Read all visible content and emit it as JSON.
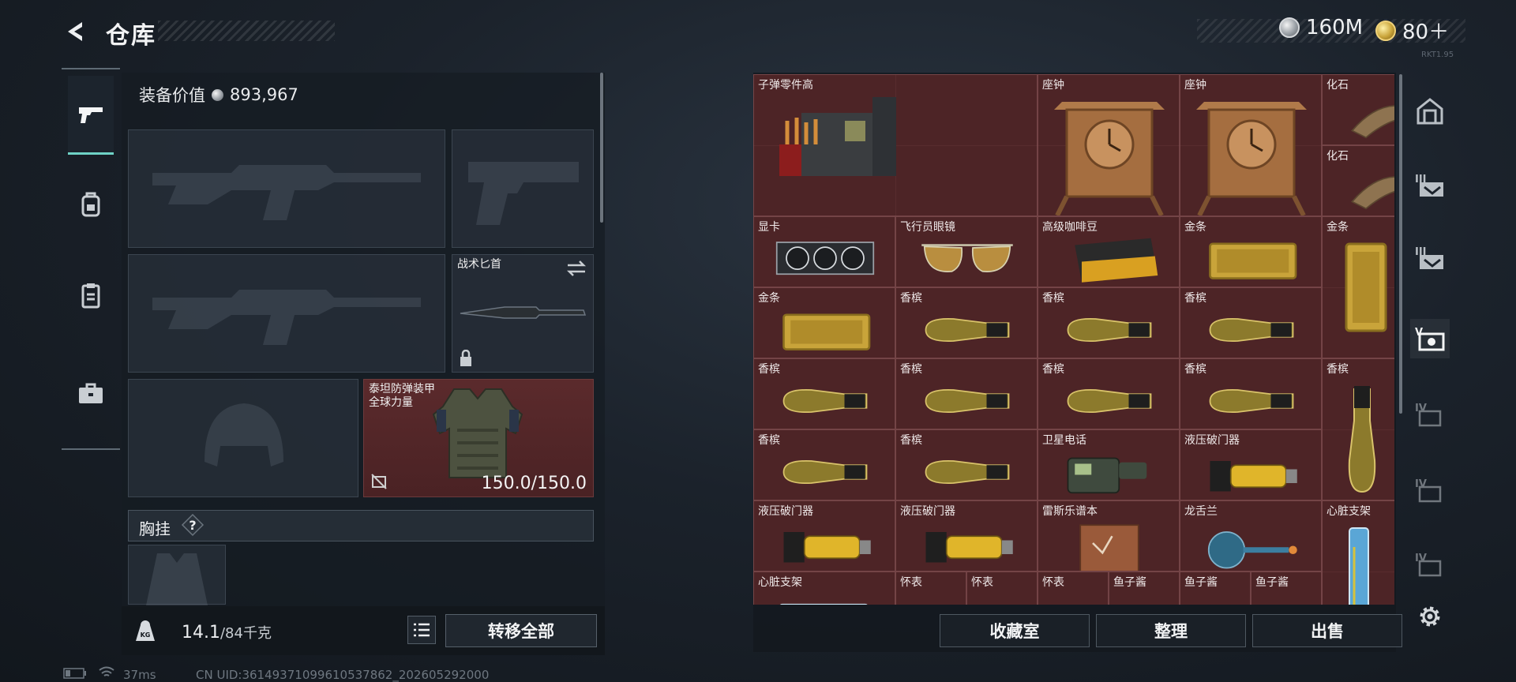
{
  "header": {
    "title": "仓库",
    "currency": [
      {
        "icon": "silver-coin-icon",
        "value": "160M"
      },
      {
        "icon": "gold-coin-icon",
        "value": "80＋"
      }
    ],
    "tiny_text": "RKT1.95"
  },
  "left_nav": [
    {
      "icon": "pistol-icon",
      "active": true
    },
    {
      "icon": "backpack-icon",
      "active": false
    },
    {
      "icon": "clipboard-icon",
      "active": false
    },
    {
      "icon": "briefcase-icon",
      "active": false
    }
  ],
  "equipment": {
    "value_label": "装备价值",
    "value": "893,967",
    "knife_label": "战术匕首",
    "armor_label": "泰坦防弹装甲\n全球力量",
    "armor_durability": "150.0/150.0",
    "vest_label": "胸挂",
    "help_symbol": "?"
  },
  "bottom": {
    "weight_current": "14.1",
    "weight_max": "/84千克",
    "transfer_all": "转移全部"
  },
  "grid": {
    "items": [
      {
        "label": "子弹零件高",
        "col": 0,
        "row": 0,
        "w": 2,
        "h": 2,
        "icon": "ammo-crate-icon"
      },
      {
        "label": "座钟",
        "col": 2,
        "row": 0,
        "w": 1,
        "h": 2,
        "icon": "clock-icon"
      },
      {
        "label": "座钟",
        "col": 3,
        "row": 0,
        "w": 1,
        "h": 2,
        "icon": "clock-icon"
      },
      {
        "label": "化石",
        "col": 4,
        "row": 0,
        "w": 1,
        "h": 1,
        "icon": "fossil-claw-icon"
      },
      {
        "label": "化石",
        "col": 4,
        "row": 1,
        "w": 1,
        "h": 1,
        "icon": "fossil-claw-icon"
      },
      {
        "label": "显卡",
        "col": 0,
        "row": 2,
        "w": 1,
        "h": 1,
        "icon": "graphics-card-icon"
      },
      {
        "label": "飞行员眼镜",
        "col": 1,
        "row": 2,
        "w": 1,
        "h": 1,
        "icon": "aviator-glasses-icon"
      },
      {
        "label": "高级咖啡豆",
        "col": 2,
        "row": 2,
        "w": 1,
        "h": 1,
        "icon": "coffee-bag-icon"
      },
      {
        "label": "金条",
        "col": 3,
        "row": 2,
        "w": 1,
        "h": 1,
        "icon": "gold-bar-icon"
      },
      {
        "label": "金条",
        "col": 4,
        "row": 2,
        "w": 1,
        "h": 2,
        "icon": "gold-bar-vertical-icon"
      },
      {
        "label": "金条",
        "col": 0,
        "row": 3,
        "w": 1,
        "h": 1,
        "icon": "gold-bar-icon"
      },
      {
        "label": "香槟",
        "col": 1,
        "row": 3,
        "w": 1,
        "h": 1,
        "icon": "champagne-icon"
      },
      {
        "label": "香槟",
        "col": 2,
        "row": 3,
        "w": 1,
        "h": 1,
        "icon": "champagne-icon"
      },
      {
        "label": "香槟",
        "col": 3,
        "row": 3,
        "w": 1,
        "h": 1,
        "icon": "champagne-icon"
      },
      {
        "label": "香槟",
        "col": 0,
        "row": 4,
        "w": 1,
        "h": 1,
        "icon": "champagne-icon"
      },
      {
        "label": "香槟",
        "col": 1,
        "row": 4,
        "w": 1,
        "h": 1,
        "icon": "champagne-icon"
      },
      {
        "label": "香槟",
        "col": 2,
        "row": 4,
        "w": 1,
        "h": 1,
        "icon": "champagne-icon"
      },
      {
        "label": "香槟",
        "col": 3,
        "row": 4,
        "w": 1,
        "h": 1,
        "icon": "champagne-icon"
      },
      {
        "label": "香槟",
        "col": 4,
        "row": 4,
        "w": 1,
        "h": 2,
        "icon": "champagne-vertical-icon"
      },
      {
        "label": "香槟",
        "col": 0,
        "row": 5,
        "w": 1,
        "h": 1,
        "icon": "champagne-icon"
      },
      {
        "label": "香槟",
        "col": 1,
        "row": 5,
        "w": 1,
        "h": 1,
        "icon": "champagne-icon"
      },
      {
        "label": "卫星电话",
        "col": 2,
        "row": 5,
        "w": 1,
        "h": 1,
        "icon": "satellite-phone-icon"
      },
      {
        "label": "液压破门器",
        "col": 3,
        "row": 5,
        "w": 1,
        "h": 1,
        "icon": "hydraulic-breacher-icon"
      },
      {
        "label": "液压破门器",
        "col": 0,
        "row": 6,
        "w": 1,
        "h": 1,
        "icon": "hydraulic-breacher-icon"
      },
      {
        "label": "液压破门器",
        "col": 1,
        "row": 6,
        "w": 1,
        "h": 1,
        "icon": "hydraulic-breacher-icon"
      },
      {
        "label": "雷斯乐谱本",
        "col": 2,
        "row": 6,
        "w": 1,
        "h": 1,
        "icon": "music-book-icon"
      },
      {
        "label": "龙舌兰",
        "col": 3,
        "row": 6,
        "w": 1,
        "h": 1,
        "icon": "tequila-bottle-icon"
      },
      {
        "label": "心脏支架",
        "col": 4,
        "row": 6,
        "w": 1,
        "h": 2,
        "icon": "heart-stent-vertical-icon"
      },
      {
        "label": "心脏支架",
        "col": 0,
        "row": 7,
        "w": 1,
        "h": 1,
        "icon": "heart-stent-icon"
      },
      {
        "label": "怀表",
        "col": 1,
        "row": 7,
        "w": 0.5,
        "h": 1,
        "icon": "pocket-watch-icon"
      },
      {
        "label": "怀表",
        "col": 1.5,
        "row": 7,
        "w": 0.5,
        "h": 1,
        "icon": "pocket-watch-icon"
      },
      {
        "label": "怀表",
        "col": 2,
        "row": 7,
        "w": 0.5,
        "h": 1,
        "icon": "pocket-watch-icon"
      },
      {
        "label": "鱼子酱",
        "col": 2.5,
        "row": 7,
        "w": 0.5,
        "h": 1,
        "icon": "caviar-tin-icon"
      },
      {
        "label": "鱼子酱",
        "col": 3,
        "row": 7,
        "w": 0.5,
        "h": 1,
        "icon": "caviar-tin-icon"
      },
      {
        "label": "鱼子酱",
        "col": 3.5,
        "row": 7,
        "w": 0.5,
        "h": 1,
        "icon": "caviar-tin-icon"
      }
    ],
    "buttons": [
      "收藏室",
      "整理",
      "出售"
    ]
  },
  "right_tabs": [
    {
      "icon": "home-vault-icon",
      "active": false
    },
    {
      "icon": "tab-iii-icon",
      "active": false
    },
    {
      "icon": "tab-iii-icon",
      "active": false
    },
    {
      "icon": "tab-v-icon",
      "active": true
    },
    {
      "icon": "tab-iv-icon",
      "active": false
    },
    {
      "icon": "tab-iv-icon",
      "active": false
    },
    {
      "icon": "tab-iv-icon",
      "active": false
    }
  ],
  "status": {
    "latency": "37ms",
    "uid": "CN UID:3614937109961053​7862_202605292000"
  },
  "colors": {
    "accent_teal": "#6fd3c6",
    "item_red": "#4a2426",
    "panel_dark": "#161c23"
  }
}
